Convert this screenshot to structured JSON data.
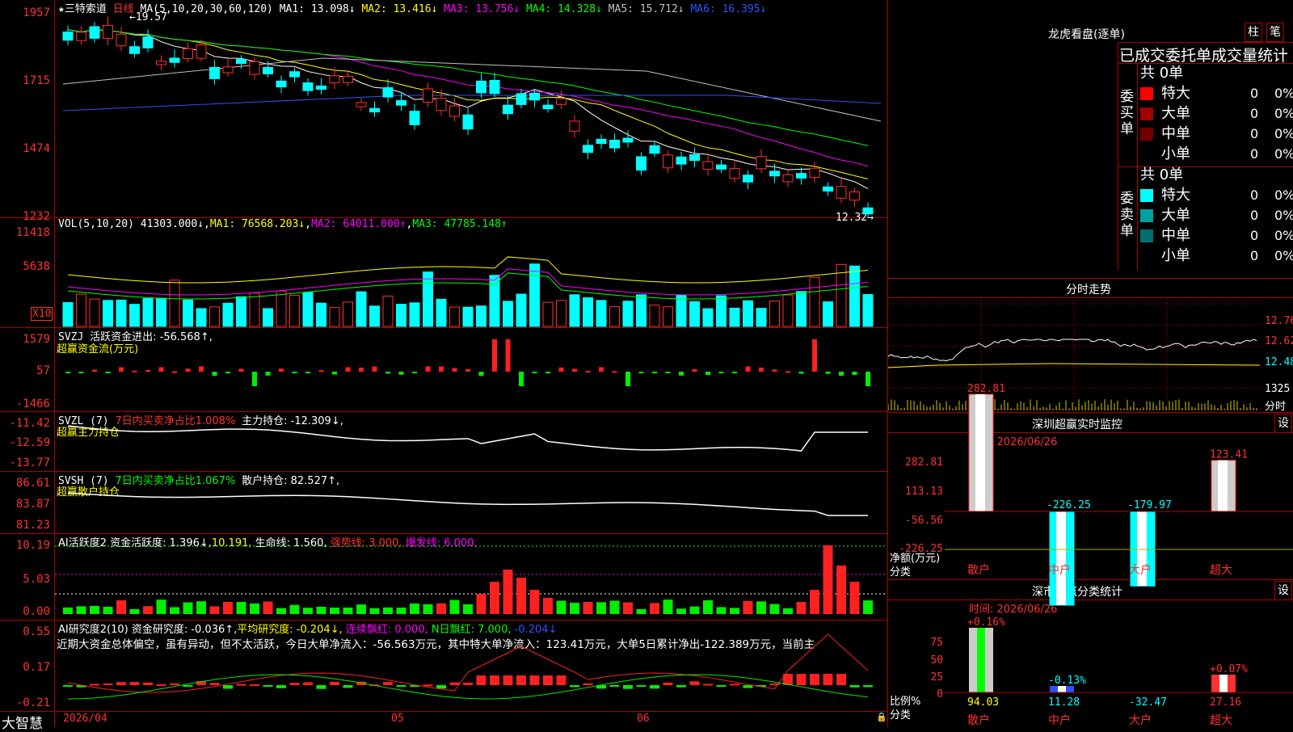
{
  "stock": {
    "name": "三特索道",
    "period": "日线",
    "star": "★"
  },
  "ma_line": {
    "prefix": "MA(5,10,20,30,60,120)",
    "items": [
      {
        "label": "MA1: 13.098↓",
        "color": "#ffffff"
      },
      {
        "label": "MA2: 13.416↓",
        "color": "#ffff00"
      },
      {
        "label": "MA3: 13.756↓",
        "color": "#ff00ff"
      },
      {
        "label": "MA4: 14.328↓",
        "color": "#00ff00"
      },
      {
        "label": "MA5: 15.712↓",
        "color": "#c0c0c0"
      },
      {
        "label": "MA6: 16.395↓",
        "color": "#3050ff"
      }
    ]
  },
  "price_axis": [
    "1957",
    "1715",
    "1474",
    "1232"
  ],
  "price_annot": {
    "high": "19.57",
    "low": "12.32"
  },
  "vol_line": {
    "prefix": "VOL(5,10,20)",
    "v": "41303.000↓",
    "ma1": "MA1: 76568.203↓",
    "ma2": "MA2: 64011.000↑",
    "ma3": "MA3: 47785.148↑"
  },
  "vol_axis": [
    "11418",
    "5638"
  ],
  "vol_unit": "X10",
  "svzj": {
    "prefix": "SVZJ",
    "label": "活跃资金进出: -56.568↑,",
    "sub": "超赢资金流(万元)",
    "axis": [
      "1579",
      "57",
      "-1466"
    ]
  },
  "svzl": {
    "prefix": "SVZL (7)",
    "pct": "7日内买卖净占比1.008%",
    "hold": "主力持仓: -12.309↓,",
    "sub": "超赢主力持仓",
    "axis": [
      "-11.42",
      "-12.59",
      "-13.77"
    ]
  },
  "svsh": {
    "prefix": "SVSH (7)",
    "pct": "7日内买卖净占比1.067%",
    "hold": "散户持仓: 82.527↑,",
    "sub": "超赢散户持仓",
    "axis": [
      "86.61",
      "83.87",
      "81.23"
    ]
  },
  "ai1": {
    "prefix": "AI活跃度2",
    "a": "资金活跃度: 1.396↓",
    "b": "10.191,",
    "c": "生命线: 1.560,",
    "d": "强势线: 3.000,",
    "e": "爆发线: 6.000,",
    "axis": [
      "10.19",
      "5.03",
      "0.00"
    ]
  },
  "ai2": {
    "prefix": "AI研究度2(10)",
    "a": "资金研究度: -0.036↑,",
    "b": "平均研究度: -0.204↓,",
    "c": "连续飘红: 0.000,",
    "d": "N日飘红: 7.000,",
    "e": "-0.204↓",
    "comment": "近期大资金总体偏空，虽有异动，但不太活跃，今日大单净流入：-56.563万元，其中特大单净流入：123.41万元，大单5日累计净出-122.389万元，当前主",
    "axis": [
      "0.55",
      "0.17",
      "-0.21"
    ]
  },
  "dates": [
    "2026/04",
    "05",
    "06"
  ],
  "brand": "大智慧",
  "right": {
    "lhkp": {
      "title": "龙虎看盘(逐单)",
      "btn1": "柱",
      "btn2": "笔",
      "tabs": "已成交委托单成交量统计",
      "buy_side": "委买单",
      "sell_side": "委卖单",
      "buy_total": "共 0单",
      "sell_total": "共 0单",
      "buy_rows": [
        {
          "k": "特大",
          "v": "0",
          "p": "0%",
          "c": "#ff0000"
        },
        {
          "k": "大单",
          "v": "0",
          "p": "0%",
          "c": "#a00000"
        },
        {
          "k": "中单",
          "v": "0",
          "p": "0%",
          "c": "#700000"
        },
        {
          "k": "小单",
          "v": "0",
          "p": "0%",
          "c": "#000000"
        }
      ],
      "sell_rows": [
        {
          "k": "特大",
          "v": "0",
          "p": "0%",
          "c": "#00ffff"
        },
        {
          "k": "大单",
          "v": "0",
          "p": "0%",
          "c": "#00a0a0"
        },
        {
          "k": "中单",
          "v": "0",
          "p": "0%",
          "c": "#007070"
        },
        {
          "k": "小单",
          "v": "0",
          "p": "0%",
          "c": "#000000"
        }
      ]
    },
    "fszs": {
      "title": "分时走势",
      "axis": [
        "12.76",
        "12.62",
        "12.48",
        "1325"
      ],
      "unit": "分时"
    },
    "szcy": {
      "title": "深圳超赢实时监控",
      "btn": "设",
      "time": "时间: 2026/06/26",
      "axis": [
        "282.81",
        "113.13",
        "-56.56",
        "-226.25"
      ],
      "ylabel": "净额(万元)",
      "xlabel": "分类",
      "cats": [
        "散户",
        "中户",
        "大户",
        "超大"
      ],
      "values": [
        282.81,
        -226.25,
        -179.97,
        123.41
      ],
      "labels": [
        "282.81",
        "-226.25",
        "-179.97",
        "123.41"
      ]
    },
    "scfl": {
      "title": "深市超赢分类统计",
      "btn": "设",
      "time": "时间: 2026/06/26",
      "axis": [
        "75",
        "50",
        "25",
        "0"
      ],
      "ylabel": "比例%",
      "xlabel": "分类",
      "cats": [
        "散户",
        "中户",
        "大户",
        "超大"
      ],
      "top": [
        "+0.16%",
        "-0.13%",
        "",
        "+0.07%"
      ],
      "bottom": [
        "94.03",
        "11.28",
        "-32.47",
        "27.16"
      ]
    }
  },
  "chart_data": {
    "type": "bar",
    "title": "深圳超赢实时监控",
    "categories": [
      "散户",
      "中户",
      "大户",
      "超大"
    ],
    "values": [
      282.81,
      -226.25,
      -179.97,
      123.41
    ],
    "ylabel": "净额(万元)",
    "xlabel": "分类"
  }
}
